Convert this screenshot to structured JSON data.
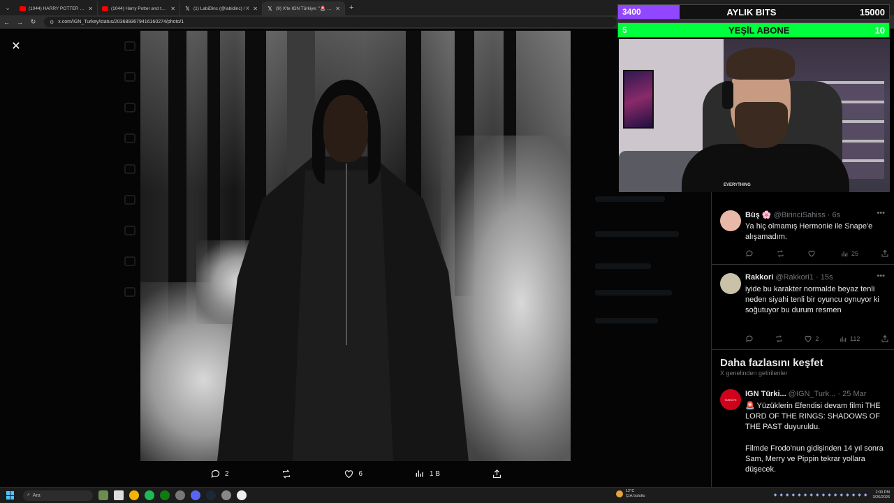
{
  "browser": {
    "tabs": [
      {
        "label": "(1044) HARRY POTTER DİZİSİ İLK...",
        "favicon": "youtube-icon",
        "active": false
      },
      {
        "label": "(1044) Harry Potter and the Phi...",
        "favicon": "youtube-icon",
        "active": false
      },
      {
        "label": "(1) LabiDinc (@labidinc) / X",
        "favicon": "x-icon",
        "active": false
      },
      {
        "label": "(9) X'te IGN Türkiye: \"🚨 Harry...",
        "favicon": "x-icon",
        "active": true
      }
    ],
    "url": "x.com/IGN_Turkey/status/2036893679416160274/photo/1"
  },
  "post_actions": {
    "replies": "2",
    "likes": "6",
    "views": "1 B"
  },
  "replies": [
    {
      "name": "Büş 🌸",
      "handle": "@BirinciSahiss · 6s",
      "text": "Ya hiç olmamış Hermonie ile Snape'e alışamadım.",
      "likes": "",
      "views": "25",
      "avatar_color": "#e8b9a8"
    },
    {
      "name": "Rakkori",
      "handle": "@Rakkori1 · 15s",
      "text": "iyide bu karakter normalde beyaz tenli neden siyahi tenli bir oyuncu oynuyor ki soğutuyor bu durum resmen",
      "likes": "2",
      "views": "112",
      "avatar_color": "#c9c2a8"
    }
  ],
  "explore": {
    "title": "Daha fazlasını keşfet",
    "subtitle": "X genelinden getirilenler",
    "tweet": {
      "name": "IGN Türki...",
      "handle": "@IGN_Turk... · 25 Mar",
      "text1": "🚨 Yüzüklerin Efendisi devam filmi THE LORD OF THE RINGS: SHADOWS OF THE PAST duyuruldu.",
      "text2": "Filmde Frodo'nun gidişinden 14 yıl sonra Sam, Merry ve Pippin tekrar yollara düşecek.",
      "avatar_color": "#d0021b",
      "avatar_label": "TÜRKİYE"
    }
  },
  "overlay": {
    "bits": {
      "current": "3400",
      "label": "AYLIK BITS",
      "goal": "15000",
      "progress": 0.2267,
      "color": "#9146ff"
    },
    "subs": {
      "current": "5",
      "label": "YEŞİL ABONE",
      "goal": "10",
      "progress": 0.5,
      "color": "#00ff3c"
    },
    "shirt_text": "EVERYTHING"
  },
  "taskbar": {
    "search_placeholder": "Ara",
    "weather_temp": "12°C",
    "weather_desc": "Çok bulutlu",
    "time": "2:00 PM",
    "date": "3/26/2026"
  }
}
